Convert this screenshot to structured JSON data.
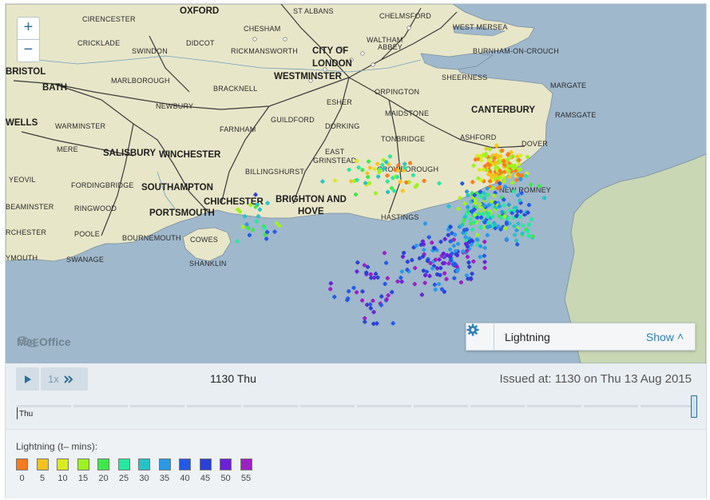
{
  "map": {
    "towns": [
      {
        "name": "OXFORD",
        "cls": "city"
      },
      {
        "name": "ST ALBANS",
        "cls": "town"
      },
      {
        "name": "CHELMSFORD",
        "cls": "town"
      },
      {
        "name": "CIRENCESTER",
        "cls": "town"
      },
      {
        "name": "CHESHAM",
        "cls": "town"
      },
      {
        "name": "WEST MERSEA",
        "cls": "town"
      },
      {
        "name": "WALTHAM",
        "cls": "town"
      },
      {
        "name": "ABBEY",
        "cls": "town"
      },
      {
        "name": "CRICKLADE",
        "cls": "town"
      },
      {
        "name": "DIDCOT",
        "cls": "town"
      },
      {
        "name": "CITY OF",
        "cls": "city"
      },
      {
        "name": "LONDON",
        "cls": "city"
      },
      {
        "name": "BURNHAM-ON-CROUCH",
        "cls": "town"
      },
      {
        "name": "SWINDON",
        "cls": "town"
      },
      {
        "name": "RICKMANSWORTH",
        "cls": "town"
      },
      {
        "name": "BRISTOL",
        "cls": "city"
      },
      {
        "name": "WESTMINSTER",
        "cls": "city"
      },
      {
        "name": "SHEERNESS",
        "cls": "town"
      },
      {
        "name": "BATH",
        "cls": "city"
      },
      {
        "name": "MARLBOROUGH",
        "cls": "town"
      },
      {
        "name": "MARGATE",
        "cls": "town"
      },
      {
        "name": "BRACKNELL",
        "cls": "town"
      },
      {
        "name": "ORPINGTON",
        "cls": "town"
      },
      {
        "name": "ESHER",
        "cls": "town"
      },
      {
        "name": "NEWBURY",
        "cls": "town"
      },
      {
        "name": "CANTERBURY",
        "cls": "city"
      },
      {
        "name": "MAIDSTONE",
        "cls": "town"
      },
      {
        "name": "RAMSGATE",
        "cls": "town"
      },
      {
        "name": "WELLS",
        "cls": "city"
      },
      {
        "name": "WARMINSTER",
        "cls": "town"
      },
      {
        "name": "GUILDFORD",
        "cls": "town"
      },
      {
        "name": "FARNHAM",
        "cls": "town"
      },
      {
        "name": "DORKING",
        "cls": "town"
      },
      {
        "name": "ASHFORD",
        "cls": "town"
      },
      {
        "name": "TONBRIDGE",
        "cls": "town"
      },
      {
        "name": "DOVER",
        "cls": "town"
      },
      {
        "name": "MERE",
        "cls": "town"
      },
      {
        "name": "SALISBURY",
        "cls": "city"
      },
      {
        "name": "WINCHESTER",
        "cls": "city"
      },
      {
        "name": "EAST",
        "cls": "town"
      },
      {
        "name": "GRINSTEAD",
        "cls": "town"
      },
      {
        "name": "YEOVIL",
        "cls": "town"
      },
      {
        "name": "BILLINGSHURST",
        "cls": "town"
      },
      {
        "name": "CROWBOROUGH",
        "cls": "town"
      },
      {
        "name": "FORDINGBRIDGE",
        "cls": "town"
      },
      {
        "name": "SOUTHAMPTON",
        "cls": "city"
      },
      {
        "name": "NEW ROMNEY",
        "cls": "town"
      },
      {
        "name": "CHICHESTER",
        "cls": "city"
      },
      {
        "name": "BRIGHTON AND",
        "cls": "city"
      },
      {
        "name": "HOVE",
        "cls": "city"
      },
      {
        "name": "RINGWOOD",
        "cls": "town"
      },
      {
        "name": "BEAMINSTER",
        "cls": "town"
      },
      {
        "name": "PORTSMOUTH",
        "cls": "city"
      },
      {
        "name": "HASTINGS",
        "cls": "town"
      },
      {
        "name": "RCHESTER",
        "cls": "town"
      },
      {
        "name": "POOLE",
        "cls": "town"
      },
      {
        "name": "BOURNEMOUTH",
        "cls": "town"
      },
      {
        "name": "COWES",
        "cls": "town"
      },
      {
        "name": "YMOUTH",
        "cls": "town"
      },
      {
        "name": "SWANAGE",
        "cls": "town"
      },
      {
        "name": "SHANKLIN",
        "cls": "town"
      }
    ],
    "zoom_in": "+",
    "zoom_out": "−",
    "brand": "Met Office",
    "layer_panel": {
      "name": "Lightning",
      "show_label": "Show",
      "show_icon": "chevron-up-icon",
      "settings_icon": "gear-icon"
    },
    "colors": {
      "sea": "#9fb8cc",
      "land": "#e8e6c8",
      "france": "#c9d7b5",
      "road": "#2f2f2f",
      "river": "#6f9fc3"
    }
  },
  "controls": {
    "play_icon": "play-icon",
    "speed_label": "1x",
    "speed_icon": "fast-forward-icon",
    "current_time": "1130 Thu",
    "issued": "Issued at: 1130 on Thu 13 Aug 2015",
    "timeline_label": "Thu"
  },
  "legend": {
    "title": "Lightning (t– mins):",
    "items": [
      {
        "label": "0",
        "color": "#f97b1e"
      },
      {
        "label": "5",
        "color": "#f7c21a"
      },
      {
        "label": "10",
        "color": "#d9ec1f"
      },
      {
        "label": "15",
        "color": "#9ef21f"
      },
      {
        "label": "20",
        "color": "#3ee84a"
      },
      {
        "label": "25",
        "color": "#27e8a0"
      },
      {
        "label": "30",
        "color": "#24c3c7"
      },
      {
        "label": "35",
        "color": "#2a99e6"
      },
      {
        "label": "40",
        "color": "#2458e6"
      },
      {
        "label": "45",
        "color": "#2b40d6"
      },
      {
        "label": "50",
        "color": "#6b20d9"
      },
      {
        "label": "55",
        "color": "#9d1fc4"
      }
    ]
  }
}
